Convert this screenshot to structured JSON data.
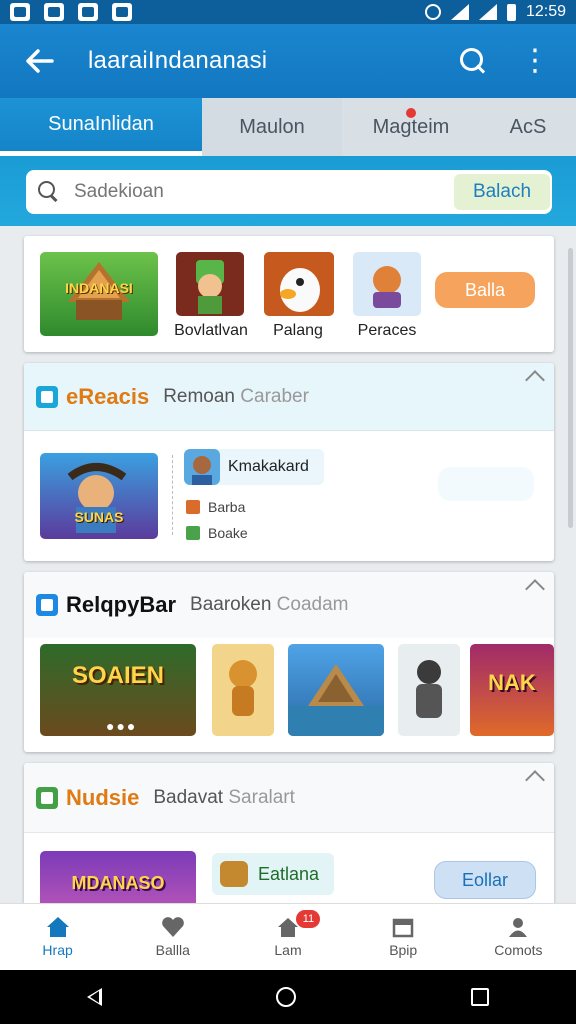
{
  "status_bar": {
    "time": "12:59"
  },
  "app_bar": {
    "title": "laaraiIndananasi"
  },
  "tabs": [
    {
      "label": "SunaInlidan"
    },
    {
      "label": "Maulon"
    },
    {
      "label": "Magteim"
    },
    {
      "label": "AcS"
    }
  ],
  "search": {
    "placeholder": "Sadekioan",
    "button": "Balach"
  },
  "featured": {
    "items": [
      {
        "label": "",
        "thumb_text": "INDANASI"
      },
      {
        "label": "Bovlatlvan"
      },
      {
        "label": "Palang"
      },
      {
        "label": "Peraces"
      }
    ],
    "button": "Balla"
  },
  "section1": {
    "title": "eReacis",
    "subtitle_main": "Remoan",
    "subtitle_faded": "Caraber",
    "thumb_text": "SUNAS",
    "profile_name": "Kmakakard",
    "rows": [
      {
        "label": "Barba"
      },
      {
        "label": "Boake"
      }
    ]
  },
  "section2": {
    "title": "RelqpyBar",
    "subtitle_main": "Baaroken",
    "subtitle_faded": "Coadam",
    "thumbs": [
      {
        "text": "SOAIEN"
      },
      {
        "text": ""
      },
      {
        "text": ""
      },
      {
        "text": ""
      },
      {
        "text": "NAK"
      }
    ]
  },
  "section3": {
    "title": "Nudsie",
    "subtitle_main": "Badavat",
    "subtitle_faded": "Saralart",
    "thumb_text": "MDANASO",
    "chip": "Eatlana",
    "button": "Eollar"
  },
  "bottom_nav": [
    {
      "label": "Hrap"
    },
    {
      "label": "Ballla"
    },
    {
      "label": "Lam",
      "badge": "11"
    },
    {
      "label": "Bpip"
    },
    {
      "label": "Comots"
    }
  ],
  "colors": {
    "primary": "#1478bf",
    "accent_orange": "#f5a15a",
    "section1_title": "#e07a12",
    "section2_title": "#111111",
    "section3_title": "#e07a12"
  }
}
